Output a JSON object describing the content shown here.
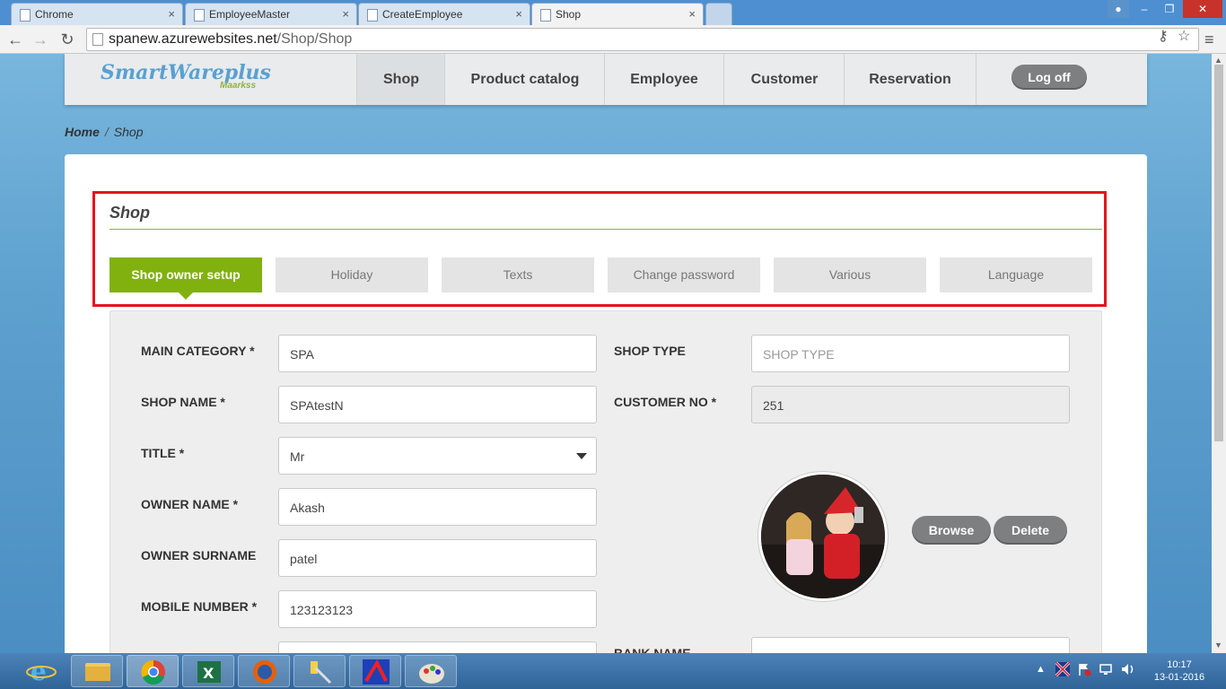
{
  "browser": {
    "tabs": [
      {
        "label": "Chrome"
      },
      {
        "label": "EmployeeMaster"
      },
      {
        "label": "CreateEmployee"
      },
      {
        "label": "Shop"
      }
    ],
    "url_host": "spanew.azurewebsites.net",
    "url_path": "/Shop/Shop"
  },
  "site": {
    "logo": "SmartWareplus",
    "logo_sub": "Maarkss",
    "nav": [
      {
        "label": "Shop",
        "active": true
      },
      {
        "label": "Product catalog"
      },
      {
        "label": "Employee"
      },
      {
        "label": "Customer"
      },
      {
        "label": "Reservation"
      }
    ],
    "logoff": "Log off"
  },
  "breadcrumb": {
    "home": "Home",
    "sep": "/",
    "current": "Shop"
  },
  "panel": {
    "title": "Shop",
    "tabs": [
      {
        "label": "Shop owner setup",
        "active": true
      },
      {
        "label": "Holiday"
      },
      {
        "label": "Texts"
      },
      {
        "label": "Change password"
      },
      {
        "label": "Various"
      },
      {
        "label": "Language"
      }
    ]
  },
  "form": {
    "main_category": {
      "label": "MAIN CATEGORY *",
      "value": "SPA"
    },
    "shop_name": {
      "label": "SHOP NAME *",
      "value": "SPAtestN"
    },
    "title": {
      "label": "TITLE *",
      "value": "Mr"
    },
    "owner_name": {
      "label": "OWNER NAME *",
      "value": "Akash"
    },
    "owner_surname": {
      "label": "OWNER SURNAME",
      "value": "patel"
    },
    "mobile_number": {
      "label": "MOBILE NUMBER *",
      "value": "123123123"
    },
    "shop_type": {
      "label": "SHOP TYPE",
      "placeholder": "SHOP TYPE"
    },
    "customer_no": {
      "label": "CUSTOMER NO *",
      "value": "251"
    },
    "bank_name": {
      "label": "BANK NAME"
    },
    "browse": "Browse",
    "delete": "Delete"
  },
  "taskbar": {
    "clock_time": "10:17",
    "clock_date": "13-01-2016"
  },
  "colors": {
    "accent_green": "#81b10e",
    "highlight_red": "#e3161d",
    "button_gray": "#7d7f81"
  }
}
